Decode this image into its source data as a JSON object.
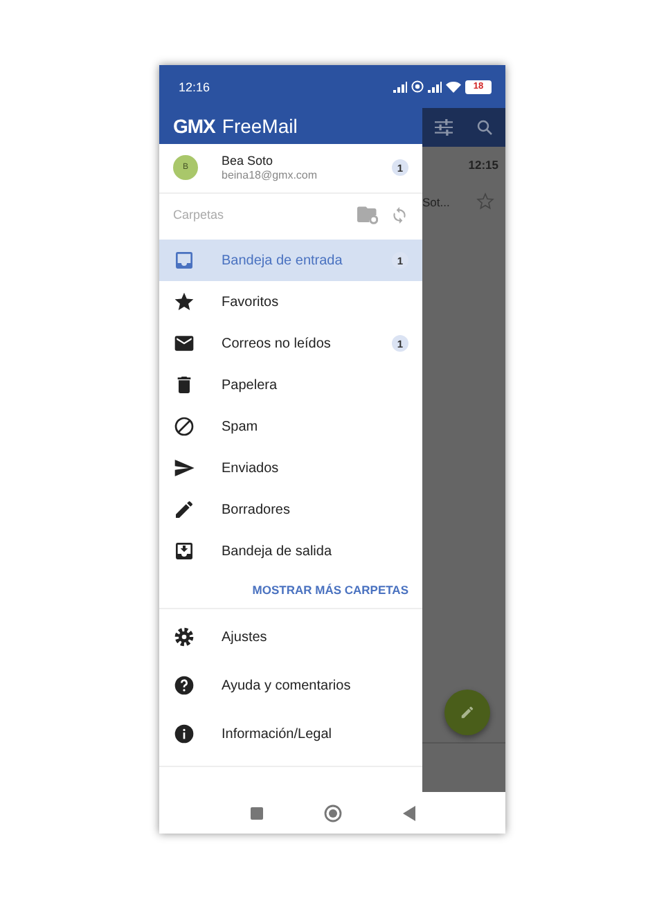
{
  "status_bar": {
    "time": "12:16",
    "battery": "18"
  },
  "app_bar": {
    "logo": "GMX",
    "title": "FreeMail"
  },
  "account": {
    "avatar": "B",
    "name": "Bea Soto",
    "email": "beina18@gmx.com",
    "badge": "1"
  },
  "folders_header": {
    "label": "Carpetas"
  },
  "folders": [
    {
      "kind": "inbox",
      "label": "Bandeja de entrada",
      "badge": "1",
      "selected": true
    },
    {
      "kind": "star",
      "label": "Favoritos",
      "selected": false
    },
    {
      "kind": "mail",
      "label": "Correos no leídos",
      "badge": "1",
      "selected": false
    },
    {
      "kind": "trash",
      "label": "Papelera",
      "selected": false
    },
    {
      "kind": "block",
      "label": "Spam",
      "selected": false
    },
    {
      "kind": "send",
      "label": "Enviados",
      "selected": false
    },
    {
      "kind": "pencil",
      "label": "Borradores",
      "selected": false
    },
    {
      "kind": "outbox",
      "label": "Bandeja de salida",
      "selected": false
    }
  ],
  "show_more": "MOSTRAR MÁS CARPETAS",
  "menu": [
    {
      "kind": "settings",
      "label": "Ajustes"
    },
    {
      "kind": "help",
      "label": "Ayuda y comentarios"
    },
    {
      "kind": "info",
      "label": "Información/Legal"
    }
  ],
  "background": {
    "time": "12:15",
    "sender": "Sot..."
  }
}
